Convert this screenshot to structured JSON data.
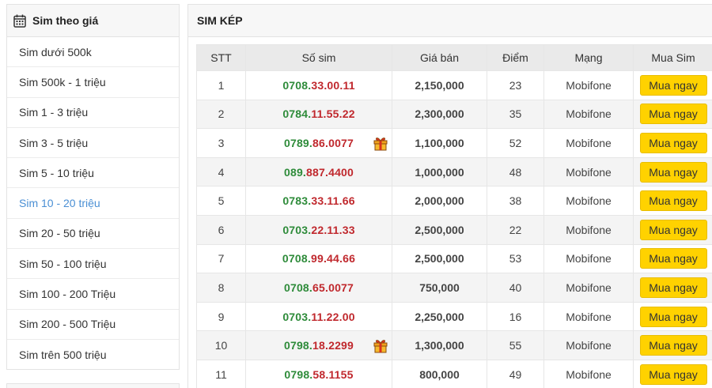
{
  "sidebar": {
    "title": "Sim theo giá",
    "icon": "calendar-icon",
    "items": [
      {
        "label": "Sim dưới 500k",
        "active": false
      },
      {
        "label": "Sim 500k - 1 triệu",
        "active": false
      },
      {
        "label": "Sim 1 - 3 triệu",
        "active": false
      },
      {
        "label": "Sim 3 - 5 triệu",
        "active": false
      },
      {
        "label": "Sim 5 - 10 triệu",
        "active": false
      },
      {
        "label": "Sim 10 - 20 triệu",
        "active": true
      },
      {
        "label": "Sim 20 - 50 triệu",
        "active": false
      },
      {
        "label": "Sim 50 - 100 triệu",
        "active": false
      },
      {
        "label": "Sim 100 - 200 Triệu",
        "active": false
      },
      {
        "label": "Sim 200 - 500 Triệu",
        "active": false
      },
      {
        "label": "Sim trên 500 triệu",
        "active": false
      }
    ]
  },
  "main": {
    "title": "SIM KÉP",
    "columns": [
      "STT",
      "Số sim",
      "Giá bán",
      "Điểm",
      "Mạng",
      "Mua Sim"
    ],
    "rows": [
      {
        "stt": "1",
        "sim_prefix": "0708.",
        "sim_suffix": "33.00.11",
        "gift": false,
        "price": "2,150,000",
        "score": "23",
        "network": "Mobifone",
        "buy": "Mua ngay"
      },
      {
        "stt": "2",
        "sim_prefix": "0784.",
        "sim_suffix": "11.55.22",
        "gift": false,
        "price": "2,300,000",
        "score": "35",
        "network": "Mobifone",
        "buy": "Mua ngay"
      },
      {
        "stt": "3",
        "sim_prefix": "0789.",
        "sim_suffix": "86.0077",
        "gift": true,
        "price": "1,100,000",
        "score": "52",
        "network": "Mobifone",
        "buy": "Mua ngay"
      },
      {
        "stt": "4",
        "sim_prefix": "089.",
        "sim_suffix": "887.4400",
        "gift": false,
        "price": "1,000,000",
        "score": "48",
        "network": "Mobifone",
        "buy": "Mua ngay"
      },
      {
        "stt": "5",
        "sim_prefix": "0783.",
        "sim_suffix": "33.11.66",
        "gift": false,
        "price": "2,000,000",
        "score": "38",
        "network": "Mobifone",
        "buy": "Mua ngay"
      },
      {
        "stt": "6",
        "sim_prefix": "0703.",
        "sim_suffix": "22.11.33",
        "gift": false,
        "price": "2,500,000",
        "score": "22",
        "network": "Mobifone",
        "buy": "Mua ngay"
      },
      {
        "stt": "7",
        "sim_prefix": "0708.",
        "sim_suffix": "99.44.66",
        "gift": false,
        "price": "2,500,000",
        "score": "53",
        "network": "Mobifone",
        "buy": "Mua ngay"
      },
      {
        "stt": "8",
        "sim_prefix": "0708.",
        "sim_suffix": "65.0077",
        "gift": false,
        "price": "750,000",
        "score": "40",
        "network": "Mobifone",
        "buy": "Mua ngay"
      },
      {
        "stt": "9",
        "sim_prefix": "0703.",
        "sim_suffix": "11.22.00",
        "gift": false,
        "price": "2,250,000",
        "score": "16",
        "network": "Mobifone",
        "buy": "Mua ngay"
      },
      {
        "stt": "10",
        "sim_prefix": "0798.",
        "sim_suffix": "18.2299",
        "gift": true,
        "price": "1,300,000",
        "score": "55",
        "network": "Mobifone",
        "buy": "Mua ngay"
      },
      {
        "stt": "11",
        "sim_prefix": "0798.",
        "sim_suffix": "58.1155",
        "gift": false,
        "price": "800,000",
        "score": "49",
        "network": "Mobifone",
        "buy": "Mua ngay"
      }
    ]
  },
  "colors": {
    "sim_prefix": "#2e8b3a",
    "sim_suffix": "#c0282d",
    "active_link": "#4a8fd4",
    "buy_button": "#ffd200",
    "network_text": "#2c4f8c"
  }
}
